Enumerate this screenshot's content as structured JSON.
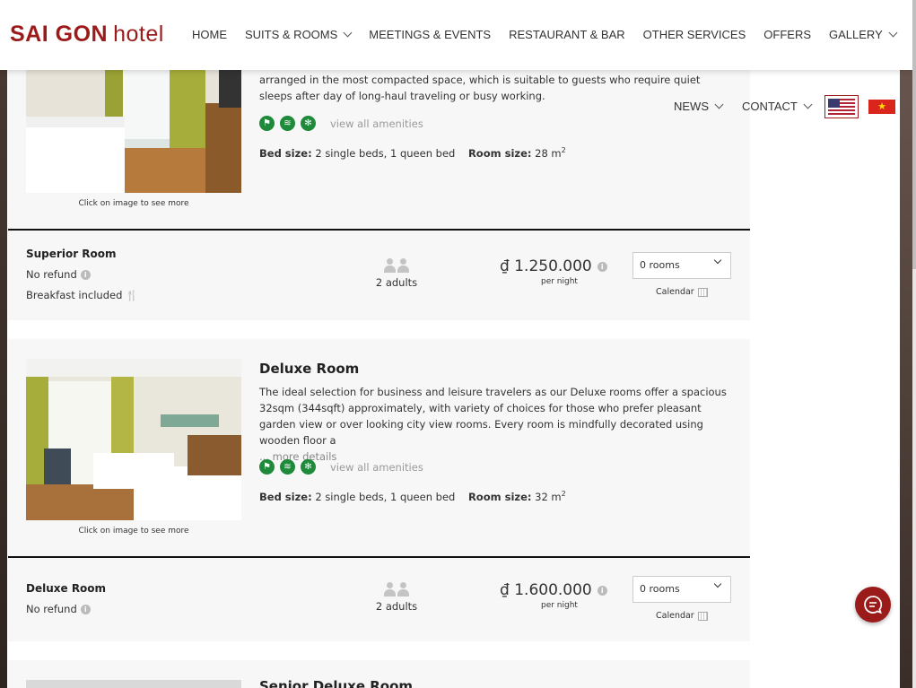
{
  "header": {
    "logo_main": "SAI GON",
    "logo_sub": "hotel",
    "nav": [
      "HOME",
      "SUITS & ROOMS",
      "MEETINGS & EVENTS",
      "RESTAURANT & BAR",
      "OTHER SERVICES",
      "OFFERS",
      "GALLERY"
    ],
    "nav_secondary": [
      "NEWS",
      "CONTACT"
    ],
    "flag_vn_symbol": "★"
  },
  "rooms": [
    {
      "description": "arranged in the most compacted space, which is suitable to guests who require quiet sleeps after day of long-haul traveling or busy working.",
      "amenities_link": "view all amenities",
      "bed_label": "Bed size:",
      "bed_value": "2 single beds, 1 queen bed",
      "room_size_label": "Room size:",
      "room_size_value": "28 m",
      "caption": "Click on image to see more",
      "rate": {
        "name": "Superior Room",
        "refund": "No refund",
        "breakfast": "Breakfast included",
        "guests": "2 adults",
        "price": "₫ 1.250.000",
        "per_night": "per night",
        "select_value": "0 rooms",
        "calendar": "Calendar"
      }
    },
    {
      "title": "Deluxe Room",
      "description": "The ideal selection for business and leisure travelers as our Deluxe rooms offer a spacious 32sqm (344sqft) approximately, with variety of choices for those who prefer pleasant garden view or over looking city view rooms. Every room is mindfully decorated using wooden floor a",
      "more": "... more details",
      "amenities_link": "view all amenities",
      "bed_label": "Bed size:",
      "bed_value": "2 single beds, 1 queen bed",
      "room_size_label": "Room size:",
      "room_size_value": "32 m",
      "caption": "Click on image to see more",
      "rate": {
        "name": "Deluxe Room",
        "refund": "No refund",
        "guests": "2 adults",
        "price": "₫ 1.600.000",
        "per_night": "per night",
        "select_value": "0 rooms",
        "calendar": "Calendar"
      }
    },
    {
      "title": "Senior Deluxe Room"
    }
  ],
  "colors": {
    "brand": "#9b1b1b",
    "amenity_green": "#1e8a3a"
  }
}
